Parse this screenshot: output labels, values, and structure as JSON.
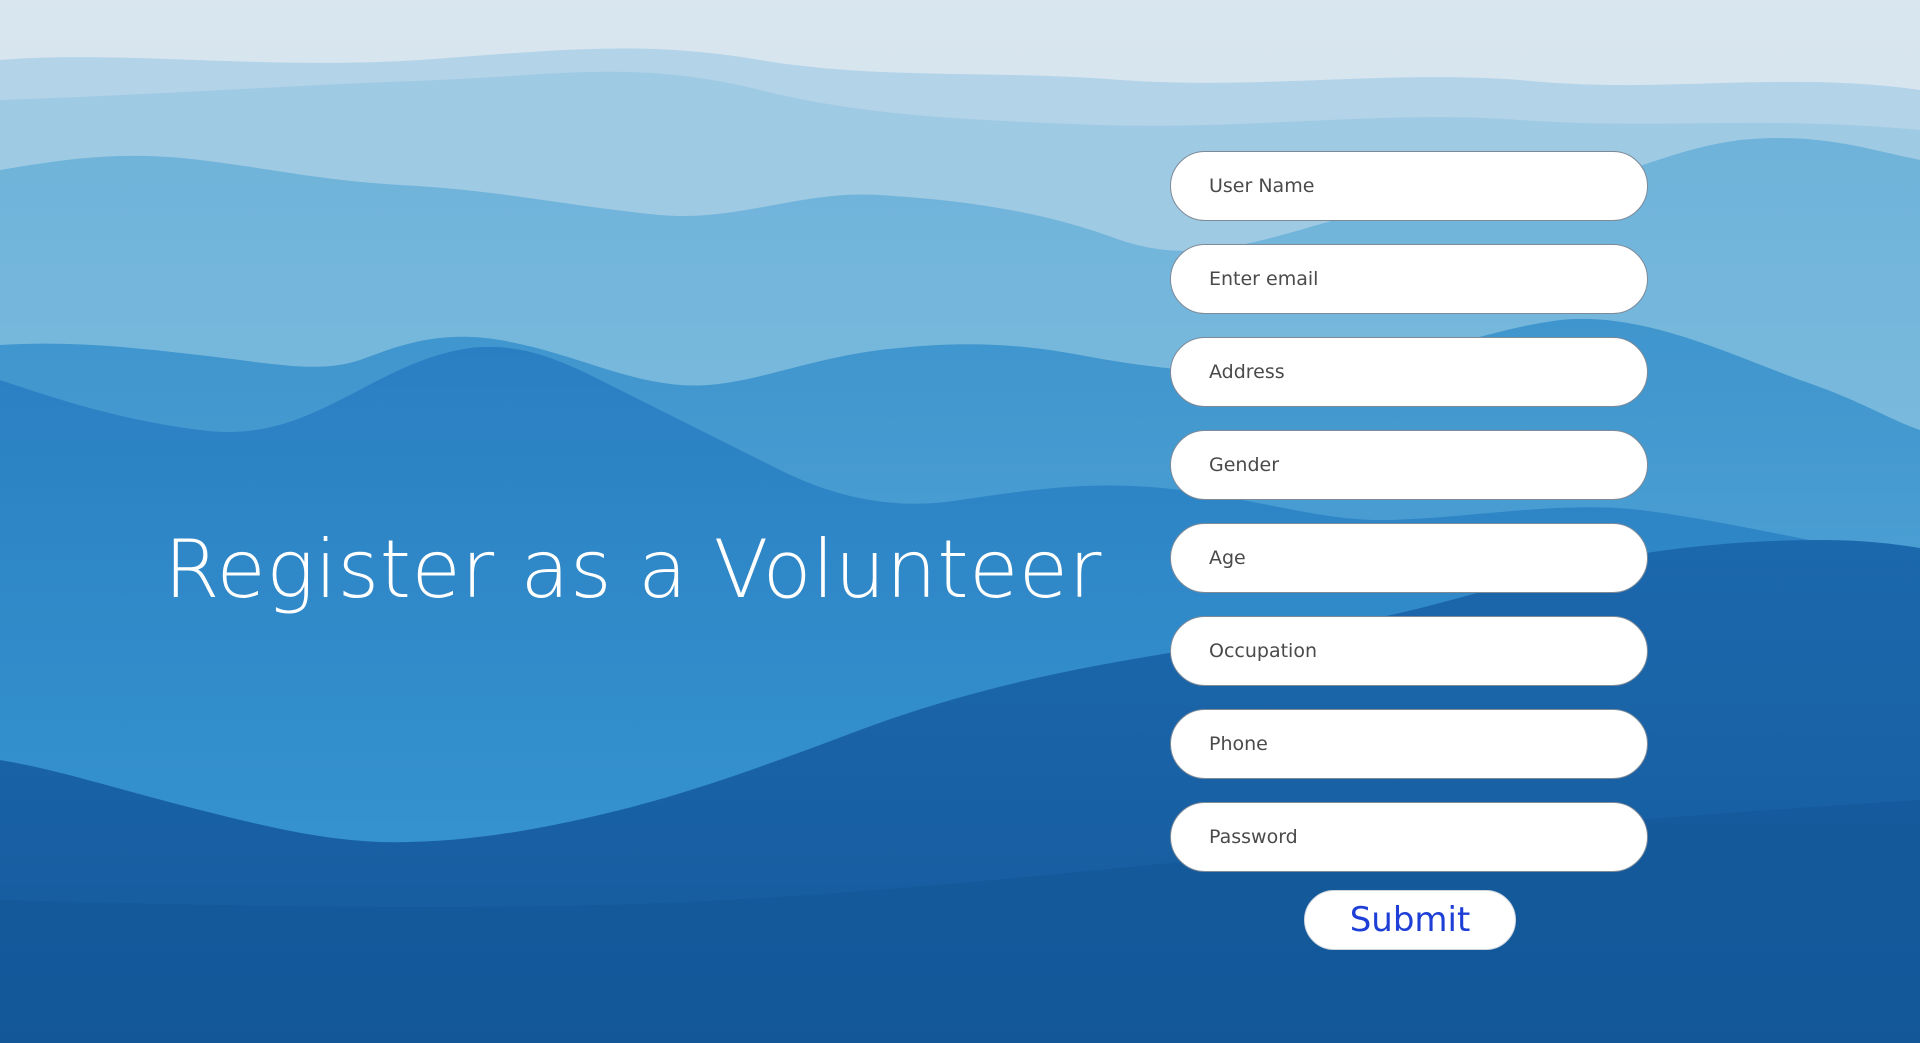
{
  "page": {
    "title": "Register as a Volunteer",
    "background": "misty-blue-mountains-image",
    "colors": {
      "sky": "#d6e4ee",
      "mountains_far": "#a9cde3",
      "mountains_mid": "#3f9fd0",
      "mountains_near": "#1a66ab",
      "title_text": "#ffffff",
      "submit_text": "#1e3fd6"
    }
  },
  "form": {
    "fields": [
      {
        "name": "username",
        "placeholder": "User Name",
        "value": ""
      },
      {
        "name": "email",
        "placeholder": "Enter email",
        "value": ""
      },
      {
        "name": "address",
        "placeholder": "Address",
        "value": ""
      },
      {
        "name": "gender",
        "placeholder": "Gender",
        "value": ""
      },
      {
        "name": "age",
        "placeholder": "Age",
        "value": ""
      },
      {
        "name": "occupation",
        "placeholder": "Occupation",
        "value": ""
      },
      {
        "name": "phone",
        "placeholder": "Phone",
        "value": ""
      },
      {
        "name": "password",
        "placeholder": "Password",
        "value": ""
      }
    ],
    "submit_label": "Submit"
  }
}
